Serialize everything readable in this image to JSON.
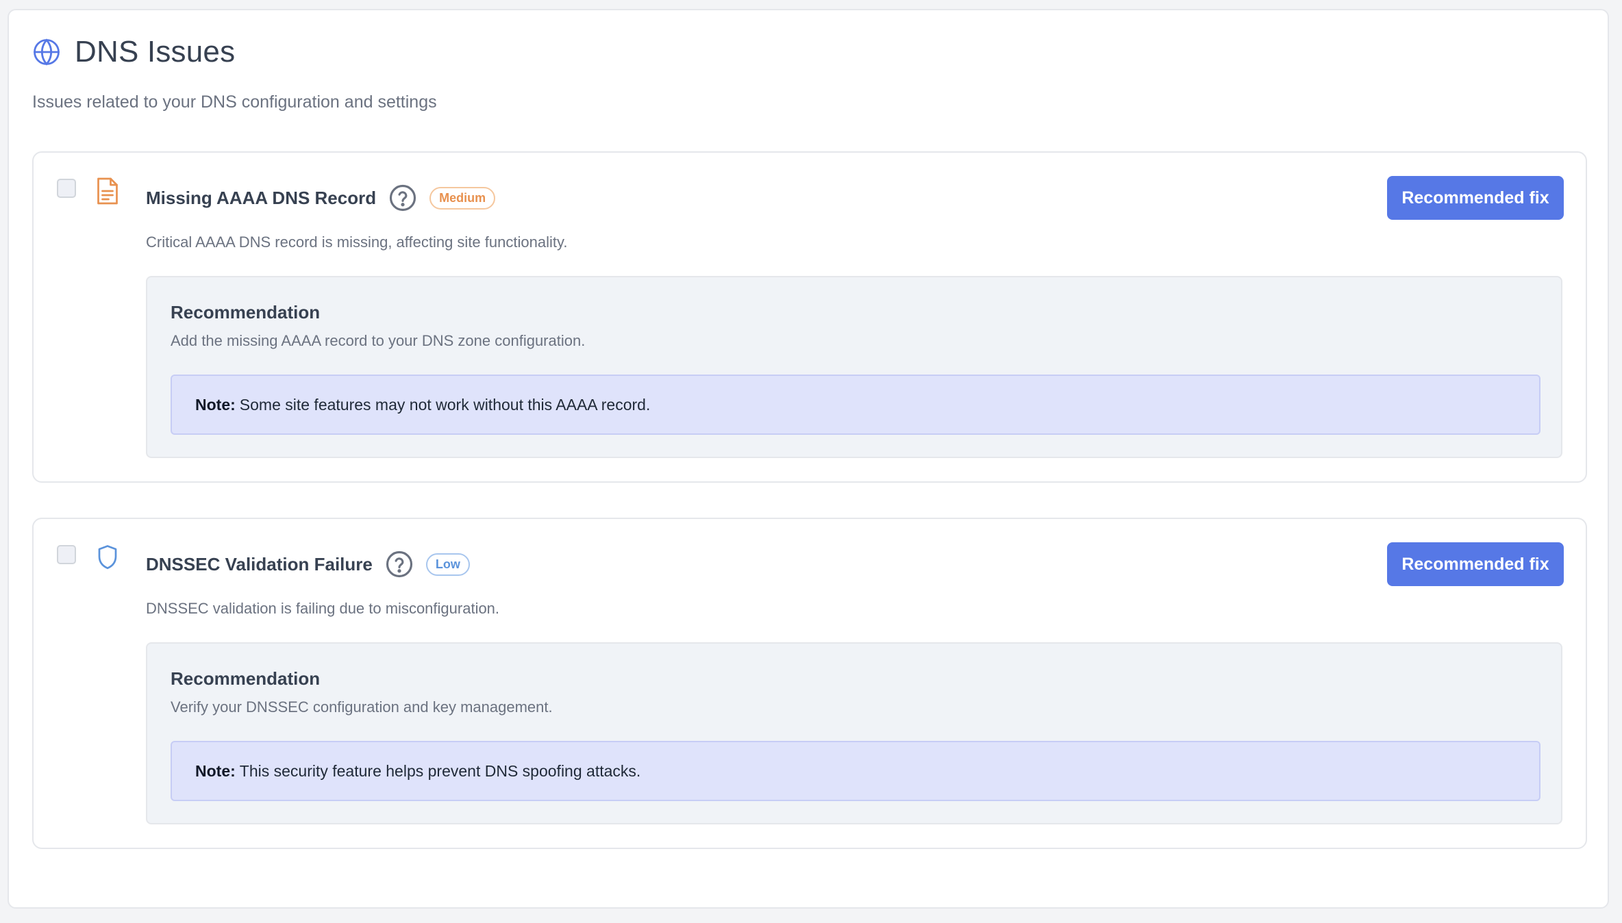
{
  "header": {
    "title": "DNS Issues",
    "subtitle": "Issues related to your DNS configuration and settings",
    "icon": "globe-icon"
  },
  "colors": {
    "accent": "#5678e6",
    "medium": "#e8914f",
    "low": "#5b93db",
    "note_bg": "#dfe3fb"
  },
  "issues": [
    {
      "icon": "document-icon",
      "title": "Missing AAAA DNS Record",
      "severity": "Medium",
      "description": "Critical AAAA DNS record is missing, affecting site functionality.",
      "fix_label": "Recommended fix",
      "recommendation_title": "Recommendation",
      "recommendation_text": "Add the missing AAAA record to your DNS zone configuration.",
      "note_label": "Note:",
      "note_text": "Some site features may not work without this AAAA record."
    },
    {
      "icon": "shield-icon",
      "title": "DNSSEC Validation Failure",
      "severity": "Low",
      "description": "DNSSEC validation is failing due to misconfiguration.",
      "fix_label": "Recommended fix",
      "recommendation_title": "Recommendation",
      "recommendation_text": "Verify your DNSSEC configuration and key management.",
      "note_label": "Note:",
      "note_text": "This security feature helps prevent DNS spoofing attacks."
    }
  ]
}
